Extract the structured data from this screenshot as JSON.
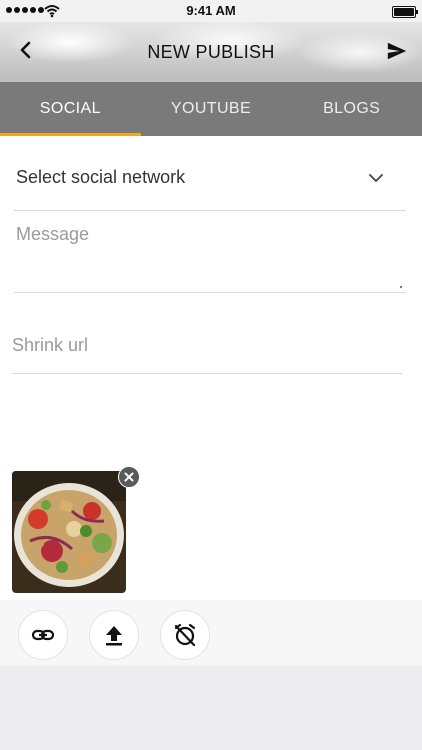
{
  "status_bar": {
    "time": "9:41 AM"
  },
  "header": {
    "title": "NEW PUBLISH"
  },
  "tabs": [
    {
      "label": "SOCIAL",
      "active": true
    },
    {
      "label": "YOUTUBE",
      "active": false
    },
    {
      "label": "BLOGS",
      "active": false
    }
  ],
  "form": {
    "network_select": {
      "label": "Select social network"
    },
    "message": {
      "placeholder": "Message"
    },
    "shrink_url": {
      "placeholder": "Shrink url"
    }
  },
  "attachments": [
    {
      "type": "image",
      "description_icon": "food-salad-photo"
    }
  ],
  "toolbar": {
    "buttons": [
      "link-icon",
      "upload-icon",
      "alarm-off-icon"
    ]
  },
  "colors": {
    "tab_bar": "#7a7a7a",
    "active_tab_indicator": "#f5a623"
  }
}
